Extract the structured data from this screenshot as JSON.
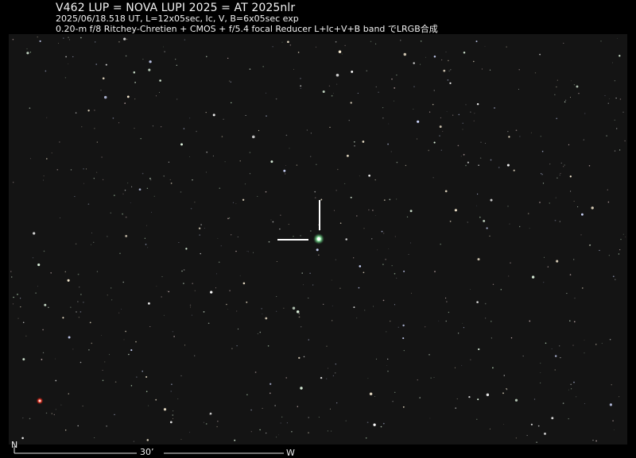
{
  "image": {
    "title": "V462 LUP = NOVA LUPI 2025 = AT 2025nlr",
    "line1": "2025/06/18.518 UT,  L=12x05sec, Ic, V, B=6x05sec exp",
    "line2": "0.20-m f/8 Ritchey-Chretien + CMOS + f/5.4 focal Reducer     L+Ic+V+B band でLRGB合成"
  },
  "orientation": {
    "north_label": "N",
    "west_label": "W",
    "scale_label": "30’"
  },
  "colors": {
    "background": "#000000",
    "field": "#141414",
    "marker": "#ffffff",
    "nova": "#7dffa0",
    "red_star": "#ff3a2a"
  }
}
